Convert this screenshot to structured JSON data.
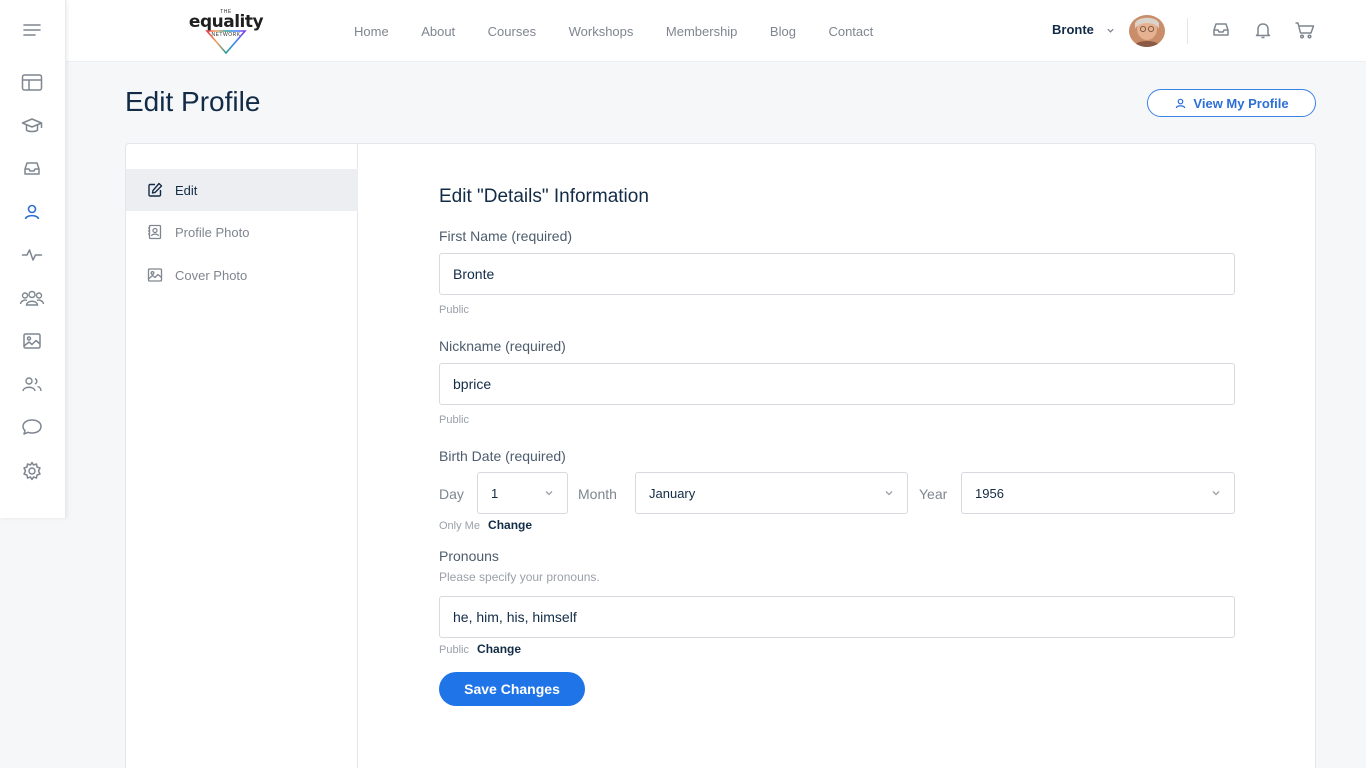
{
  "brand": {
    "logo_top": "THE",
    "logo_main": "equality",
    "logo_bottom": "NETWORK"
  },
  "nav": [
    {
      "label": "Home"
    },
    {
      "label": "About"
    },
    {
      "label": "Courses"
    },
    {
      "label": "Workshops"
    },
    {
      "label": "Membership"
    },
    {
      "label": "Blog"
    },
    {
      "label": "Contact"
    }
  ],
  "user": {
    "name": "Bronte"
  },
  "rail": [
    "menu-icon",
    "dashboard-icon",
    "courses-icon",
    "inbox-icon",
    "profile-icon",
    "activity-icon",
    "groups-icon",
    "photos-icon",
    "members-icon",
    "forums-icon",
    "settings-icon"
  ],
  "page": {
    "title": "Edit Profile",
    "view_profile_label": "View My Profile"
  },
  "subnav": [
    {
      "label": "Edit",
      "active": true
    },
    {
      "label": "Profile Photo",
      "active": false
    },
    {
      "label": "Cover Photo",
      "active": false
    }
  ],
  "form": {
    "title": "Edit \"Details\" Information",
    "first_name": {
      "label": "First Name (required)",
      "value": "Bronte",
      "visibility": "Public"
    },
    "nickname": {
      "label": "Nickname (required)",
      "value": "bprice",
      "visibility": "Public"
    },
    "birth_date": {
      "label": "Birth Date (required)",
      "day_label": "Day",
      "day_value": "1",
      "month_label": "Month",
      "month_value": "January",
      "year_label": "Year",
      "year_value": "1956",
      "visibility": "Only Me",
      "change_label": "Change"
    },
    "pronouns": {
      "label": "Pronouns",
      "hint": "Please specify your pronouns.",
      "value": "he, him, his, himself",
      "visibility": "Public",
      "change_label": "Change"
    },
    "save_label": "Save Changes"
  },
  "colors": {
    "accent": "#1f74e8",
    "text": "#122b46",
    "muted": "#7f868f"
  }
}
